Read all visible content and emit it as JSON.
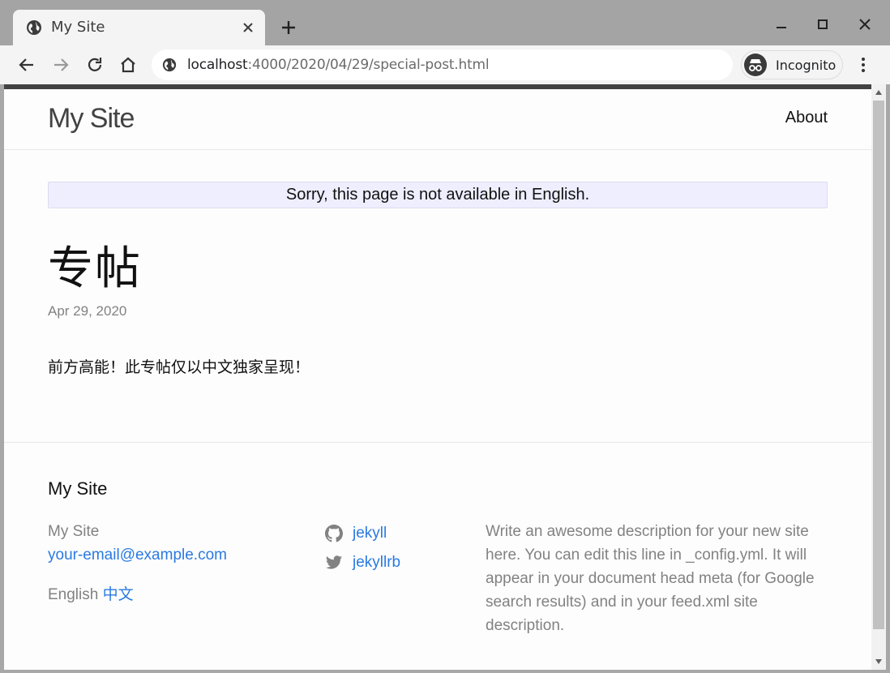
{
  "browser": {
    "tab": {
      "title": "My Site"
    },
    "address": {
      "host": "localhost",
      "path": ":4000/2020/04/29/special-post.html"
    },
    "incognito_label": "Incognito"
  },
  "site": {
    "title": "My Site",
    "nav": {
      "about": "About"
    }
  },
  "page": {
    "notice": "Sorry, this page is not available in English.",
    "post_title": "专帖",
    "date": "Apr 29, 2020",
    "body": "前方高能！此专帖仅以中文独家呈现！"
  },
  "footer": {
    "heading": "My Site",
    "name": "My Site",
    "email": "your-email@example.com",
    "lang_current": "English",
    "lang_alt": "中文",
    "social": {
      "github": "jekyll",
      "twitter": "jekyllrb"
    },
    "description": "Write an awesome description for your new site here. You can edit this line in _config.yml. It will appear in your document head meta (for Google search results) and in your feed.xml site description."
  },
  "colors": {
    "link": "#2a7ae2",
    "notice_bg": "#eeeeff",
    "header_stripe": "#424242",
    "muted_text": "#828282"
  },
  "icons": [
    "globe-icon",
    "close-icon",
    "plus-icon",
    "minimize-icon",
    "maximize-icon",
    "window-close-icon",
    "back-arrow-icon",
    "forward-arrow-icon",
    "reload-icon",
    "home-icon",
    "incognito-icon",
    "kebab-menu-icon",
    "github-icon",
    "twitter-icon"
  ]
}
